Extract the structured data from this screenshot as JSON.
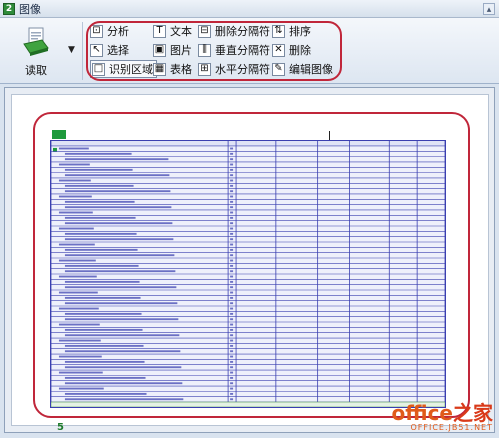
{
  "window": {
    "badge": "2",
    "title": "图像"
  },
  "ribbon": {
    "read_label": "读取",
    "tools": [
      {
        "id": "analyze",
        "label": "分析",
        "icon": "analyze-icon",
        "glyph": "⊡"
      },
      {
        "id": "text",
        "label": "文本",
        "icon": "text-icon",
        "glyph": "T"
      },
      {
        "id": "delete-separator",
        "label": "删除分隔符",
        "icon": "delete-separator-icon",
        "glyph": "⊟"
      },
      {
        "id": "sort",
        "label": "排序",
        "icon": "sort-icon",
        "glyph": "⇅"
      },
      {
        "id": "select",
        "label": "选择",
        "icon": "cursor-icon",
        "glyph": "↖"
      },
      {
        "id": "picture",
        "label": "图片",
        "icon": "picture-icon",
        "glyph": "▣"
      },
      {
        "id": "vertical-separator",
        "label": "垂直分隔符",
        "icon": "vertical-separator-icon",
        "glyph": "⫼"
      },
      {
        "id": "delete",
        "label": "删除",
        "icon": "delete-icon",
        "glyph": "✕"
      },
      {
        "id": "recognize-region",
        "label": "识别区域",
        "icon": "region-icon",
        "glyph": "□"
      },
      {
        "id": "table",
        "label": "表格",
        "icon": "table-icon",
        "glyph": "▦"
      },
      {
        "id": "horizontal-separator",
        "label": "水平分隔符",
        "icon": "horizontal-separator-icon",
        "glyph": "⊞"
      },
      {
        "id": "edit-image",
        "label": "编辑图像",
        "icon": "edit-image-icon",
        "glyph": "✎"
      }
    ]
  },
  "document": {
    "page_number": "5",
    "rows": 48,
    "columns": 10,
    "cells": [
      "一、全面落实“十二五”规划各项任务",
      "三、加快转变经济发展方式",
      "四、推进经济结构战略性调整",
      "五、深化改革开放",
      "六、保障和改善民生"
    ]
  },
  "watermark": {
    "brand": "office",
    "brand_zh": "之家",
    "url": "OFFICE.JB51.NET"
  },
  "colors": {
    "highlight": "#c0263a",
    "table_line": "#3a3fb0",
    "accent_green": "#1e9a3c"
  }
}
